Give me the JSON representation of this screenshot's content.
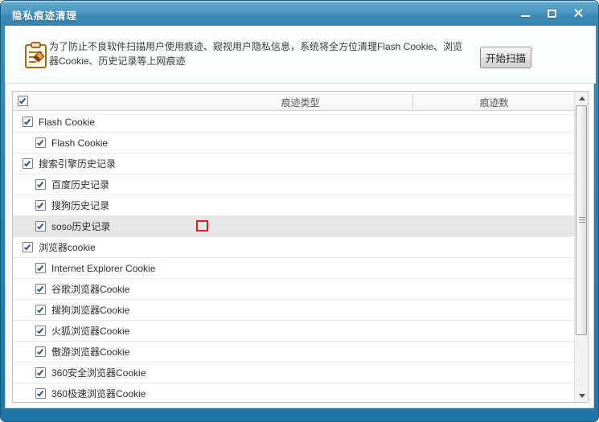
{
  "window": {
    "title": "隐私痕迹清理",
    "controls": [
      {
        "name": "minimize"
      },
      {
        "name": "maximize"
      },
      {
        "name": "close"
      }
    ]
  },
  "header_panel": {
    "icon": "clipboard-pencil-icon",
    "description": "为了防止不良软件扫描用户使用痕迹、窥视用户隐私信息，系统将全方位清理Flash Cookie、浏览器Cookie、历史记录等上网痕迹",
    "scan_button_label": "开始扫描"
  },
  "table": {
    "columns": [
      {
        "label": "痕迹类型"
      },
      {
        "label": "痕迹数"
      }
    ],
    "select_all_checked": true,
    "rows": [
      {
        "label": "Flash Cookie",
        "level": 0,
        "checked": true
      },
      {
        "label": "Flash Cookie",
        "level": 1,
        "checked": true
      },
      {
        "label": "搜索引擎历史记录",
        "level": 0,
        "checked": true
      },
      {
        "label": "百度历史记录",
        "level": 1,
        "checked": true
      },
      {
        "label": "搜狗历史记录",
        "level": 1,
        "checked": true
      },
      {
        "label": "soso历史记录",
        "level": 1,
        "checked": true,
        "highlighted": true,
        "annotation": true
      },
      {
        "label": "浏览器cookie",
        "level": 0,
        "checked": true
      },
      {
        "label": "Internet Explorer Cookie",
        "level": 1,
        "checked": true
      },
      {
        "label": "谷歌浏览器Cookie",
        "level": 1,
        "checked": true
      },
      {
        "label": "搜狗浏览器Cookie",
        "level": 1,
        "checked": true
      },
      {
        "label": "火狐浏览器Cookie",
        "level": 1,
        "checked": true
      },
      {
        "label": "傲游浏览器Cookie",
        "level": 1,
        "checked": true
      },
      {
        "label": "360安全浏览器Cookie",
        "level": 1,
        "checked": true
      },
      {
        "label": "360极速浏览器Cookie",
        "level": 1,
        "checked": true
      }
    ]
  },
  "colors": {
    "titlebar_blue": "#3a8bb8",
    "frame_blue": "#2e82b1",
    "row_highlight": "#e6e6e6",
    "annotation_red": "#e8171d",
    "checkbox_tick": "#39587f"
  }
}
